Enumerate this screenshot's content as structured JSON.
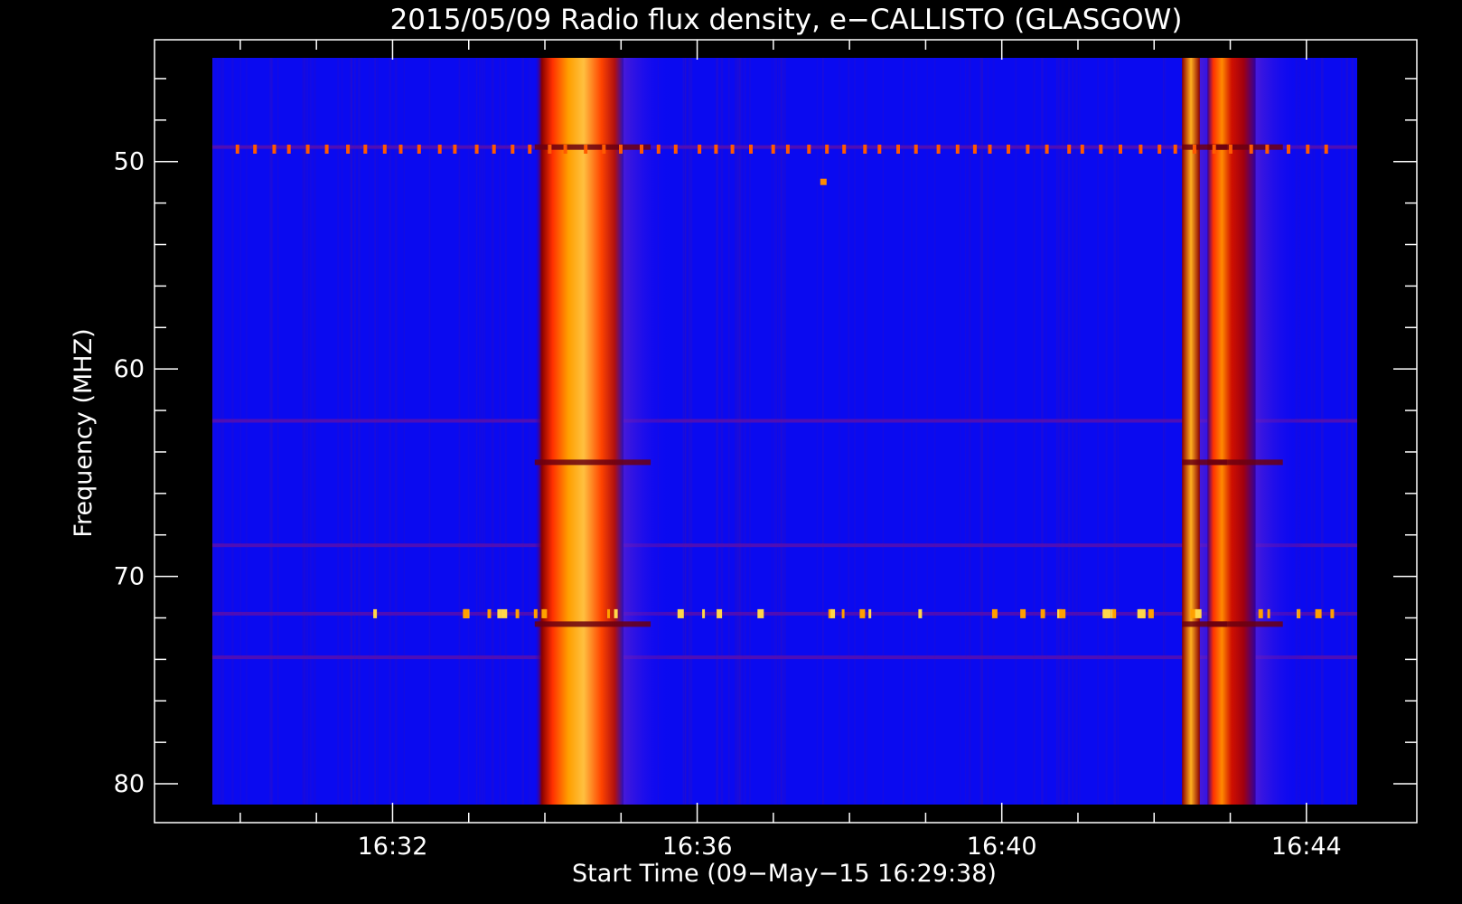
{
  "chart_data": {
    "type": "heatmap",
    "title": "2015/05/09  Radio flux density, e−CALLISTO (GLASGOW)",
    "xlabel": "Start Time (09−May−15 16:29:38)",
    "ylabel": "Frequency (MHZ)",
    "x_ticks": [
      "16:32",
      "16:36",
      "16:40",
      "16:44"
    ],
    "y_ticks": [
      "50",
      "60",
      "70",
      "80"
    ],
    "xlim": [
      "16:29:38",
      "16:44:40"
    ],
    "ylim": [
      45.0,
      81.0
    ],
    "y_axis": "frequency increases downward",
    "colormap": [
      "#0000ff",
      "#8a0000",
      "#ff2a00",
      "#ff9a00",
      "#ffd84a"
    ],
    "background_color": "#0a0af0",
    "events": [
      {
        "name": "burst",
        "start": "16:33:52",
        "end": "16:35:02",
        "freq_range": [
          45,
          81
        ],
        "peak_intensity": "high"
      },
      {
        "name": "burst",
        "start": "16:42:22",
        "end": "16:42:36",
        "freq_range": [
          45,
          81
        ],
        "peak_intensity": "high"
      },
      {
        "name": "burst",
        "start": "16:42:42",
        "end": "16:43:20",
        "freq_range": [
          45,
          81
        ],
        "peak_intensity": "high"
      }
    ],
    "interference_lines_mhz": [
      49.3,
      62.5,
      68.5,
      71.8,
      73.9
    ]
  }
}
